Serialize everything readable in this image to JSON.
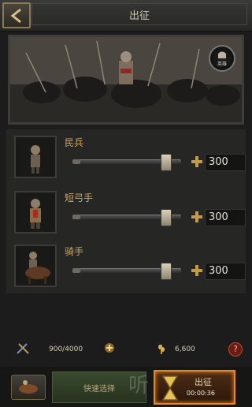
{
  "header": {
    "title": "出征"
  },
  "banner": {
    "badge_label": "英雄"
  },
  "troops": [
    {
      "name": "民兵",
      "count": "300",
      "fill": 0.85
    },
    {
      "name": "短弓手",
      "count": "300",
      "fill": 0.85
    },
    {
      "name": "骑手",
      "count": "300",
      "fill": 0.85
    }
  ],
  "resources": {
    "troop_capacity": "900/4000",
    "food": "6,600"
  },
  "bottom": {
    "quick_select": "快速选择",
    "march": "出征",
    "timer": "00:00:36"
  },
  "watermark": "听"
}
